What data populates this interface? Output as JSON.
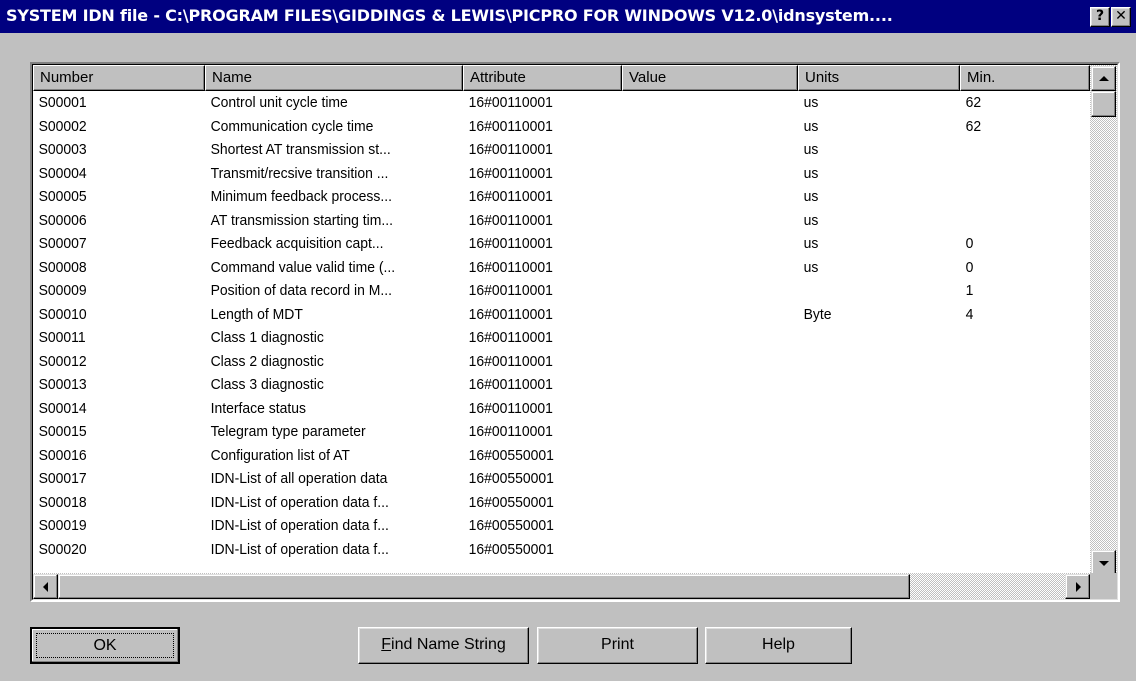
{
  "window": {
    "title": "SYSTEM IDN file - C:\\PROGRAM FILES\\GIDDINGS & LEWIS\\PICPRO FOR WINDOWS V12.0\\idnsystem....",
    "help_glyph": "?",
    "close_glyph": "✕"
  },
  "list": {
    "columns": [
      "Number",
      "Name",
      "Attribute",
      "Value",
      "Units",
      "Min."
    ],
    "rows": [
      {
        "number": "S00001",
        "name": "Control unit cycle time",
        "attribute": "16#00110001",
        "value": "",
        "units": "us",
        "min": "62"
      },
      {
        "number": "S00002",
        "name": "Communication cycle time",
        "attribute": "16#00110001",
        "value": "",
        "units": "us",
        "min": "62"
      },
      {
        "number": "S00003",
        "name": "Shortest AT transmission st...",
        "attribute": "16#00110001",
        "value": "",
        "units": "us",
        "min": ""
      },
      {
        "number": "S00004",
        "name": "Transmit/recsive transition ...",
        "attribute": "16#00110001",
        "value": "",
        "units": "us",
        "min": ""
      },
      {
        "number": "S00005",
        "name": "Minimum feedback process...",
        "attribute": "16#00110001",
        "value": "",
        "units": "us",
        "min": ""
      },
      {
        "number": "S00006",
        "name": "AT transmission starting tim...",
        "attribute": "16#00110001",
        "value": "",
        "units": "us",
        "min": ""
      },
      {
        "number": "S00007",
        "name": "Feedback acquisition capt...",
        "attribute": "16#00110001",
        "value": "",
        "units": "us",
        "min": "0"
      },
      {
        "number": "S00008",
        "name": "Command value valid time (...",
        "attribute": "16#00110001",
        "value": "",
        "units": "us",
        "min": "0"
      },
      {
        "number": "S00009",
        "name": "Position of data record in M...",
        "attribute": "16#00110001",
        "value": "",
        "units": "",
        "min": "1"
      },
      {
        "number": "S00010",
        "name": "Length of MDT",
        "attribute": "16#00110001",
        "value": "",
        "units": "Byte",
        "min": "4"
      },
      {
        "number": "S00011",
        "name": "Class 1 diagnostic",
        "attribute": "16#00110001",
        "value": "",
        "units": "",
        "min": ""
      },
      {
        "number": "S00012",
        "name": "Class 2 diagnostic",
        "attribute": "16#00110001",
        "value": "",
        "units": "",
        "min": ""
      },
      {
        "number": "S00013",
        "name": "Class 3 diagnostic",
        "attribute": "16#00110001",
        "value": "",
        "units": "",
        "min": ""
      },
      {
        "number": "S00014",
        "name": "Interface status",
        "attribute": "16#00110001",
        "value": "",
        "units": "",
        "min": ""
      },
      {
        "number": "S00015",
        "name": "Telegram type parameter",
        "attribute": "16#00110001",
        "value": "",
        "units": "",
        "min": ""
      },
      {
        "number": "S00016",
        "name": "Configuration list of AT",
        "attribute": "16#00550001",
        "value": "",
        "units": "",
        "min": ""
      },
      {
        "number": "S00017",
        "name": "IDN-List of all operation data",
        "attribute": "16#00550001",
        "value": "",
        "units": "",
        "min": ""
      },
      {
        "number": "S00018",
        "name": "IDN-List of operation data f...",
        "attribute": "16#00550001",
        "value": "",
        "units": "",
        "min": ""
      },
      {
        "number": "S00019",
        "name": "IDN-List of operation data f...",
        "attribute": "16#00550001",
        "value": "",
        "units": "",
        "min": ""
      },
      {
        "number": "S00020",
        "name": "IDN-List of operation data f...",
        "attribute": "16#00550001",
        "value": "",
        "units": "",
        "min": ""
      }
    ]
  },
  "buttons": {
    "ok": "OK",
    "find_prefix": "F",
    "find_rest": "ind Name String",
    "print": "Print",
    "help": "Help"
  },
  "icons": {
    "scroll_up": "arrow-up-icon",
    "scroll_down": "arrow-down-icon",
    "scroll_left": "arrow-left-icon",
    "scroll_right": "arrow-right-icon"
  }
}
